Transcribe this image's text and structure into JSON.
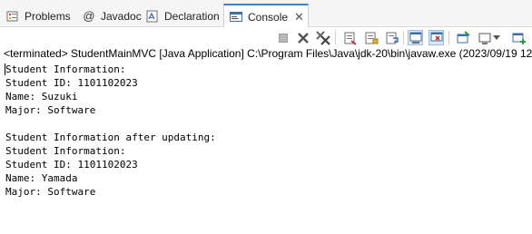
{
  "tabs": [
    {
      "label": "Problems",
      "icon": "problems-icon",
      "active": false
    },
    {
      "label": "Javadoc",
      "icon": "javadoc-icon",
      "active": false
    },
    {
      "label": "Declaration",
      "icon": "declaration-icon",
      "active": false
    },
    {
      "label": "Console",
      "icon": "console-icon",
      "active": true,
      "close_label": "✕"
    }
  ],
  "toolbar": {
    "icons": [
      "terminate-icon",
      "remove-launch-icon",
      "remove-all-terminated-icon",
      "clear-console-icon",
      "scroll-lock-icon",
      "word-wrap-icon",
      "show-console-on-stdout-icon",
      "show-console-on-stderr-icon",
      "pin-console-icon",
      "display-selected-console-icon",
      "open-console-icon"
    ]
  },
  "status_text": "<terminated> StudentMainMVC [Java Application] C:\\Program Files\\Java\\jdk-20\\bin\\javaw.exe  (2023/09/19 12",
  "console_lines": [
    "Student Information:",
    "Student ID: 1101102023",
    "Name: Suzuki",
    "Major: Software",
    "",
    "Student Information after updating:",
    "Student Information:",
    "Student ID: 1101102023",
    "Name: Yamada",
    "Major: Software"
  ],
  "colors": {
    "active_tab_accent": "#3c7fd0",
    "terminate_red": "#c8332b",
    "tab_bar_bg": "#f5f5f5"
  }
}
